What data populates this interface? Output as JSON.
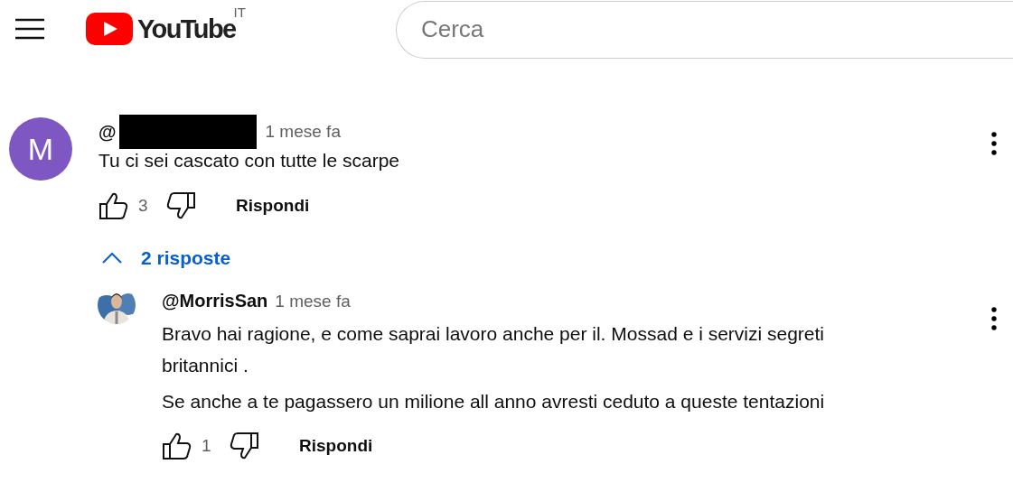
{
  "header": {
    "logo": "YouTube",
    "country": "IT",
    "search": {
      "placeholder": "Cerca"
    }
  },
  "comments": [
    {
      "avatar": {
        "kind": "letter",
        "letter": "M",
        "color": "#7e57c2"
      },
      "author": "@",
      "redacted": true,
      "time": "1 mese fa",
      "text": [
        "Tu ci sei cascato con tutte le scarpe"
      ],
      "likes": "3",
      "reply_label": "Rispondi",
      "replies_toggle": {
        "label": "2 risposte",
        "expanded": true
      },
      "replies": [
        {
          "author": "@MorrisSan",
          "redacted": false,
          "time": "1 mese fa",
          "text": [
            "Bravo hai ragione, e come saprai lavoro anche per il. Mossad e i servizi segreti britannici .",
            "Se anche a te pagassero un milione all anno avresti ceduto a queste tentazioni"
          ],
          "likes": "1",
          "reply_label": "Rispondi"
        }
      ]
    }
  ]
}
